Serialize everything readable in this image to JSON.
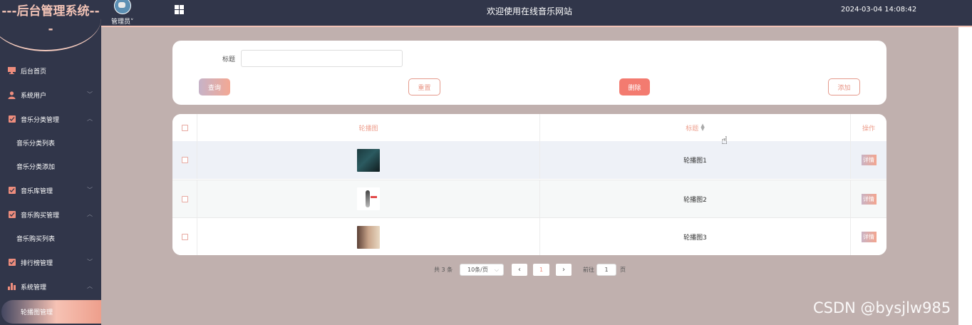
{
  "app": {
    "brand_title": "---后台管理系统---"
  },
  "header": {
    "user": "管理员˅",
    "welcome": "欢迎使用在线音乐网站",
    "datetime": "2024-03-04 14:08:42"
  },
  "sidebar": {
    "items": [
      {
        "label": "后台首页",
        "icon": "monitor-icon"
      },
      {
        "label": "系统用户",
        "icon": "user-icon",
        "arrow": "﹀"
      },
      {
        "label": "音乐分类管理",
        "icon": "check-icon",
        "arrow": "︿"
      },
      {
        "label": "音乐分类列表"
      },
      {
        "label": "音乐分类添加"
      },
      {
        "label": "音乐库管理",
        "icon": "check-icon",
        "arrow": "﹀"
      },
      {
        "label": "音乐购买管理",
        "icon": "check-icon",
        "arrow": "︿"
      },
      {
        "label": "音乐购买列表"
      },
      {
        "label": "排行榜管理",
        "icon": "check-icon",
        "arrow": "﹀"
      },
      {
        "label": "系统管理",
        "icon": "chart-icon",
        "arrow": "︿"
      },
      {
        "label": "轮播图管理"
      }
    ]
  },
  "search": {
    "label": "标题",
    "value": "",
    "buttons": {
      "query": "查询",
      "reset": "重置",
      "delete": "删除",
      "add": "添加"
    }
  },
  "table": {
    "columns": {
      "image": "轮播图",
      "title": "标题",
      "actions": "操作"
    },
    "rows": [
      {
        "title": "轮播图1",
        "action": "详情"
      },
      {
        "title": "轮播图2",
        "action": "详情"
      },
      {
        "title": "轮播图3",
        "action": "详情"
      }
    ]
  },
  "pagination": {
    "total": "共 3 条",
    "page_size": "10条/页",
    "current_page": "1",
    "goto_label": "前往",
    "goto_value": "1",
    "page_unit": "页"
  },
  "watermark": "CSDN @bysjlw985",
  "colors": {
    "sidebar_bg": "#31364a",
    "accent": "#ee8d7d",
    "content_bg": "#c0b0ae"
  }
}
